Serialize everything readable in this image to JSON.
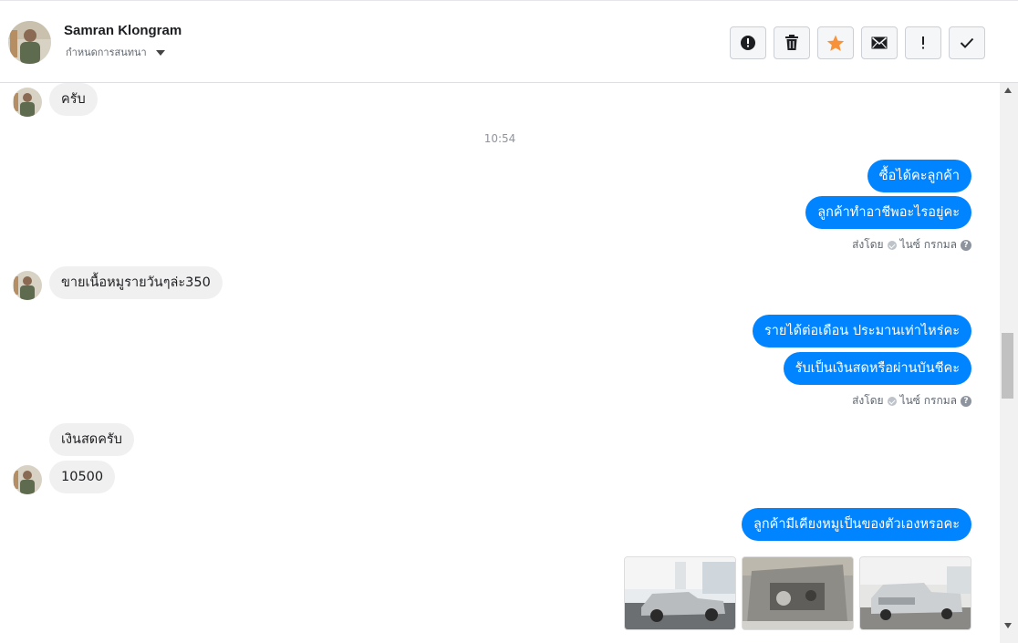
{
  "header": {
    "name": "Samran Klongram",
    "subtitle": "กำหนดการสนทนา",
    "actions": [
      "report-icon",
      "trash-icon",
      "star-icon",
      "mail-icon",
      "important-icon",
      "done-icon"
    ],
    "star_color": "#f7923b"
  },
  "messages": {
    "m1": "ครับ",
    "time1": "10:54",
    "m2": "ซื้อได้คะลูกค้า",
    "m3": "ลูกค้าทำอาชีพอะไรอยู่คะ",
    "sent1_prefix": "ส่งโดย",
    "sent1_name": "ไนซ์ กรกมล",
    "m4": "ขายเนื้อหมูรายวันๆล่ะ350",
    "m5": "รายได้ต่อเดือน ประมานเท่าไหร่คะ",
    "m6": "รับเป็นเงินสดหรือผ่านบันชีคะ",
    "sent2_prefix": "ส่งโดย",
    "sent2_name": "ไนซ์ กรกมล",
    "m7": "เงินสดครับ",
    "m8": "10500",
    "m9": "ลูกค้ามีเคียงหมูเป็นของตัวเองหรอคะ"
  },
  "colors": {
    "outgoing": "#0084ff",
    "incoming": "#f1f0f0"
  }
}
